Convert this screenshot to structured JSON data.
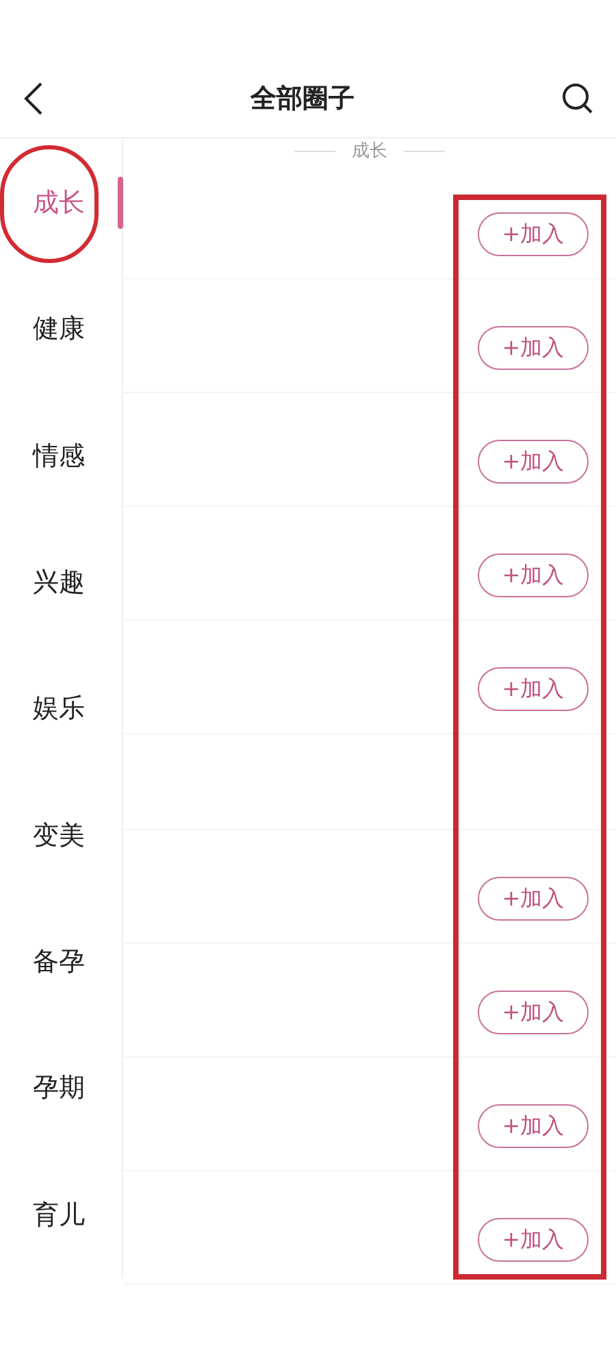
{
  "header": {
    "title": "全部圈子"
  },
  "sidebar": {
    "items": [
      {
        "label": "成长",
        "selected": true
      },
      {
        "label": "健康",
        "selected": false
      },
      {
        "label": "情感",
        "selected": false
      },
      {
        "label": "兴趣",
        "selected": false
      },
      {
        "label": "娱乐",
        "selected": false
      },
      {
        "label": "变美",
        "selected": false
      },
      {
        "label": "备孕",
        "selected": false
      },
      {
        "label": "孕期",
        "selected": false
      },
      {
        "label": "育儿",
        "selected": false
      }
    ]
  },
  "section": {
    "title": "成长"
  },
  "rows": [
    {
      "button": "+加入"
    },
    {
      "button": "+加入"
    },
    {
      "button": "+加入"
    },
    {
      "button": "+加入"
    },
    {
      "button": "+加入"
    },
    {},
    {
      "button": "+加入"
    },
    {
      "button": "+加入"
    },
    {
      "button": "+加入"
    },
    {
      "button": "+加入"
    }
  ]
}
